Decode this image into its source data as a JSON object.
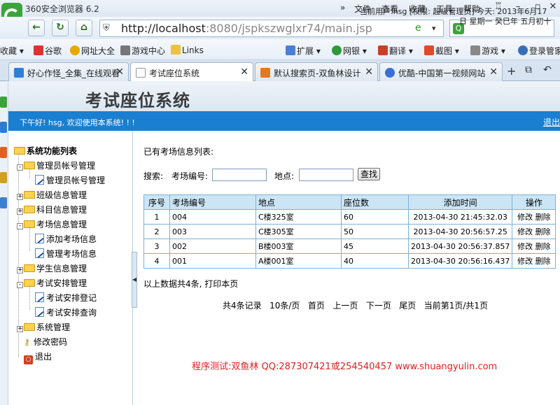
{
  "browser": {
    "app_title": "360安全浏览器 6.2",
    "menus": [
      "文件",
      "查看",
      "收藏",
      "工具",
      "帮助"
    ],
    "url_host": "http://localhost",
    "url_rest": ":8080/jspkszwglxr74/main.jsp",
    "favorites": [
      "收藏",
      "谷歌",
      "网址大全",
      "游戏中心",
      "Links",
      "扩展",
      "网银",
      "翻译",
      "截图",
      "游戏",
      "登录管家"
    ],
    "tabs": [
      {
        "label": "好心作怪_全集_在线观看",
        "active": false
      },
      {
        "label": "考试座位系统",
        "active": true
      },
      {
        "label": "默认搜索页-双鱼林设计",
        "active": false
      },
      {
        "label": "优酷-中国第一视频网站",
        "active": false
      }
    ]
  },
  "header": {
    "title": "考试座位系统",
    "user_info": "当前用户:hsg [权限: 超级管理员] 今天:  2013年6月17",
    "date_info": "日 星期一 癸巳年 五月初十"
  },
  "welcome": {
    "text": "下午好! hsg, 欢迎使用本系统! ! !",
    "logout": "退出"
  },
  "sidebar": {
    "root": "系统功能列表",
    "items": [
      {
        "label": "管理员帐号管理",
        "type": "folder",
        "level": 1,
        "sign": "-"
      },
      {
        "label": "管理员帐号管理",
        "type": "doc",
        "level": 2
      },
      {
        "label": "班级信息管理",
        "type": "folder",
        "level": 1,
        "sign": "+"
      },
      {
        "label": "科目信息管理",
        "type": "folder",
        "level": 1,
        "sign": "+"
      },
      {
        "label": "考场信息管理",
        "type": "folder",
        "level": 1,
        "sign": "-"
      },
      {
        "label": "添加考场信息",
        "type": "doc",
        "level": 2
      },
      {
        "label": "管理考场信息",
        "type": "doc",
        "level": 2
      },
      {
        "label": "学生信息管理",
        "type": "folder",
        "level": 1,
        "sign": "+"
      },
      {
        "label": "考试安排管理",
        "type": "folder",
        "level": 1,
        "sign": "-"
      },
      {
        "label": "考试安排登记",
        "type": "doc",
        "level": 2
      },
      {
        "label": "考试安排查询",
        "type": "doc",
        "level": 2
      },
      {
        "label": "系统管理",
        "type": "folder",
        "level": 1,
        "sign": "+"
      },
      {
        "label": "修改密码",
        "type": "key",
        "level": 1
      },
      {
        "label": "退出",
        "type": "exit",
        "level": 1
      }
    ]
  },
  "main": {
    "list_title": "已有考场信息列表:",
    "search_label": "搜索:",
    "code_label": "考场编号:",
    "place_label": "地点:",
    "search_button": "查找",
    "columns": [
      "序号",
      "考场编号",
      "地点",
      "座位数",
      "添加时间",
      "操作"
    ],
    "rows": [
      {
        "no": "1",
        "code": "004",
        "place": "C楼325室",
        "seats": "60",
        "time": "2013-04-30 21:45:32.03",
        "edit": "修改",
        "del": "删除"
      },
      {
        "no": "2",
        "code": "003",
        "place": "C楼305室",
        "seats": "50",
        "time": "2013-04-30 20:56:57.25",
        "edit": "修改",
        "del": "删除"
      },
      {
        "no": "3",
        "code": "002",
        "place": "B楼003室",
        "seats": "45",
        "time": "2013-04-30 20:56:37.857",
        "edit": "修改",
        "del": "删除"
      },
      {
        "no": "4",
        "code": "001",
        "place": "A楼001室",
        "seats": "40",
        "time": "2013-04-30 20:56:16.437",
        "edit": "修改",
        "del": "删除"
      }
    ],
    "summary_prefix": "以上数据共4条,",
    "print_link": "打印本页",
    "pager": {
      "total": "共4条记录",
      "per_page": "10条/页",
      "first": "首页",
      "prev": "上一页",
      "next": "下一页",
      "last": "尾页",
      "current": "当前第1页/共1页"
    },
    "footer": "程序测试:双鱼林 QQ:287307421或254540457 www.shuangyulin.com"
  },
  "colors": {
    "welcome_bar": "#1a7fd0",
    "table_header": "#cbe5f5",
    "table_border": "#7fb0d8",
    "footer": "#e02020"
  }
}
